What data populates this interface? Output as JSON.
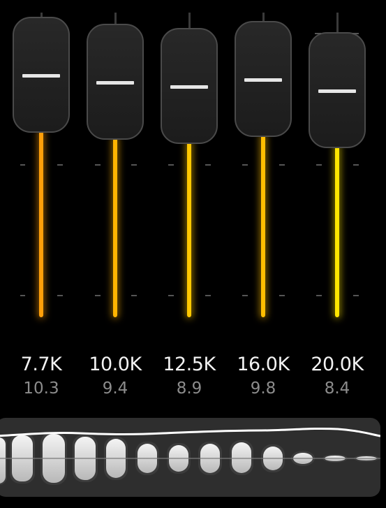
{
  "bands": [
    {
      "freq": "7.7K",
      "gain": "10.3",
      "color": "#ff9f0a"
    },
    {
      "freq": "10.0K",
      "gain": "9.4",
      "color": "#ffb400"
    },
    {
      "freq": "12.5K",
      "gain": "8.9",
      "color": "#ffc800"
    },
    {
      "freq": "16.0K",
      "gain": "9.8",
      "color": "#ffbd00"
    },
    {
      "freq": "20.0K",
      "gain": "8.4",
      "color": "#ffe600"
    }
  ],
  "colors": {
    "background": "#000000",
    "knob": "#222222",
    "knob_border": "#4a4a4a",
    "knob_line": "#e6e6e6",
    "overview_bg": "#2e2e2e"
  }
}
